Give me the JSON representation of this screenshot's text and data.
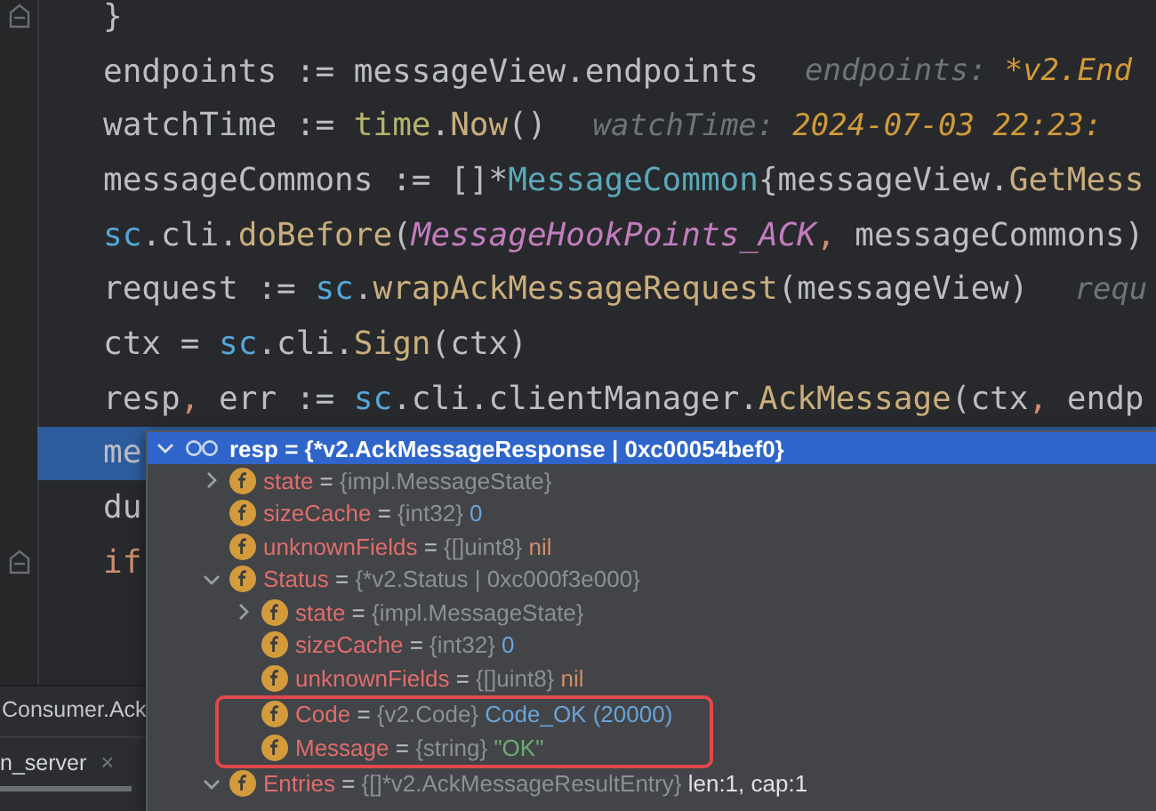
{
  "editor": {
    "lines": [
      {
        "fold": true,
        "current": false,
        "tokens": [
          {
            "text": "}",
            "kind": "plain"
          }
        ]
      },
      {
        "fold": false,
        "current": false,
        "tokens": [
          {
            "text": "endpoints := messageView.endpoints",
            "kind": "plain"
          }
        ],
        "hint": [
          {
            "text": "endpoints:",
            "kind": "hint-name"
          },
          {
            "text": "*v2.End",
            "kind": "hint-value"
          }
        ]
      },
      {
        "fold": false,
        "current": false,
        "tokens": [
          {
            "text": "watchTime := ",
            "kind": "plain"
          },
          {
            "text": "time",
            "kind": "package"
          },
          {
            "text": ".",
            "kind": "plain"
          },
          {
            "text": "Now",
            "kind": "func"
          },
          {
            "text": "()",
            "kind": "plain"
          }
        ],
        "hint": [
          {
            "text": "watchTime:",
            "kind": "hint-name"
          },
          {
            "text": "2024-07-03 22:23:",
            "kind": "hint-value"
          }
        ]
      },
      {
        "fold": false,
        "current": false,
        "tokens": [
          {
            "text": "messageCommons := []*",
            "kind": "plain"
          },
          {
            "text": "MessageCommon",
            "kind": "type"
          },
          {
            "text": "{messageView.",
            "kind": "plain"
          },
          {
            "text": "GetMess",
            "kind": "func"
          }
        ]
      },
      {
        "fold": false,
        "current": false,
        "tokens": [
          {
            "text": "sc",
            "kind": "receiver"
          },
          {
            "text": ".cli.",
            "kind": "plain"
          },
          {
            "text": "doBefore",
            "kind": "func"
          },
          {
            "text": "(",
            "kind": "plain"
          },
          {
            "text": "MessageHookPoints_ACK",
            "kind": "constant"
          },
          {
            "text": ",",
            "kind": "keyword"
          },
          {
            "text": " messageCommons)",
            "kind": "plain"
          }
        ]
      },
      {
        "fold": false,
        "current": false,
        "tokens": [
          {
            "text": "request := ",
            "kind": "plain"
          },
          {
            "text": "sc",
            "kind": "receiver"
          },
          {
            "text": ".",
            "kind": "plain"
          },
          {
            "text": "wrapAckMessageRequest",
            "kind": "func"
          },
          {
            "text": "(messageView)",
            "kind": "plain"
          }
        ],
        "hint": [
          {
            "text": "requ",
            "kind": "hint-name"
          }
        ]
      },
      {
        "fold": false,
        "current": false,
        "tokens": [
          {
            "text": "ctx = ",
            "kind": "plain"
          },
          {
            "text": "sc",
            "kind": "receiver"
          },
          {
            "text": ".cli.",
            "kind": "plain"
          },
          {
            "text": "Sign",
            "kind": "func"
          },
          {
            "text": "(ctx)",
            "kind": "plain"
          }
        ]
      },
      {
        "fold": false,
        "current": false,
        "tokens": [
          {
            "text": "resp",
            "kind": "plain"
          },
          {
            "text": ",",
            "kind": "keyword"
          },
          {
            "text": " err := ",
            "kind": "plain"
          },
          {
            "text": "sc",
            "kind": "receiver"
          },
          {
            "text": ".cli.clientManager.",
            "kind": "plain"
          },
          {
            "text": "AckMessage",
            "kind": "func"
          },
          {
            "text": "(ctx",
            "kind": "plain"
          },
          {
            "text": ",",
            "kind": "keyword"
          },
          {
            "text": " endp",
            "kind": "plain"
          }
        ]
      },
      {
        "fold": false,
        "current": true,
        "tokens": [
          {
            "text": "me",
            "kind": "plain"
          }
        ]
      },
      {
        "fold": false,
        "current": false,
        "tokens": [
          {
            "text": "du",
            "kind": "plain"
          }
        ]
      },
      {
        "fold": true,
        "current": false,
        "tokens": [
          {
            "text": "if",
            "kind": "keyword"
          }
        ]
      }
    ]
  },
  "debug_popup": {
    "root": {
      "name": "resp",
      "sep": "=",
      "value": "{*v2.AckMessageResponse | 0xc00054bef0}",
      "expanded": true,
      "children": [
        {
          "name": "state",
          "sep": "=",
          "type": "{impl.MessageState}",
          "expanded": false
        },
        {
          "name": "sizeCache",
          "sep": "=",
          "type": "{int32}",
          "value": "0",
          "color": "#6aa3d8"
        },
        {
          "name": "unknownFields",
          "sep": "=",
          "type": "{[]uint8}",
          "value": "nil",
          "color": "#cf8e6d"
        },
        {
          "name": "Status",
          "sep": "=",
          "type": "{*v2.Status | 0xc000f3e000}",
          "expanded": true,
          "children": [
            {
              "name": "state",
              "sep": "=",
              "type": "{impl.MessageState}",
              "expanded": false
            },
            {
              "name": "sizeCache",
              "sep": "=",
              "type": "{int32}",
              "value": "0",
              "color": "#6aa3d8"
            },
            {
              "name": "unknownFields",
              "sep": "=",
              "type": "{[]uint8}",
              "value": "nil",
              "color": "#cf8e6d"
            },
            {
              "name": "Code",
              "sep": "=",
              "type": "{v2.Code}",
              "value": "Code_OK (20000)",
              "color": "#6aa3d8",
              "outlined": true
            },
            {
              "name": "Message",
              "sep": "=",
              "type": "{string}",
              "value": "\"OK\"",
              "color": "#6aab73",
              "outlined": true
            }
          ]
        },
        {
          "name": "Entries",
          "sep": "=",
          "type": "{[]*v2.AckMessageResultEntry}",
          "value": "len:1, cap:1",
          "color": "#dfe1e5",
          "expanded": true
        }
      ]
    }
  },
  "bottom_panel": {
    "breadcrumb": "Consumer.Ack",
    "tab": {
      "label": "n_server",
      "close": "×"
    }
  }
}
